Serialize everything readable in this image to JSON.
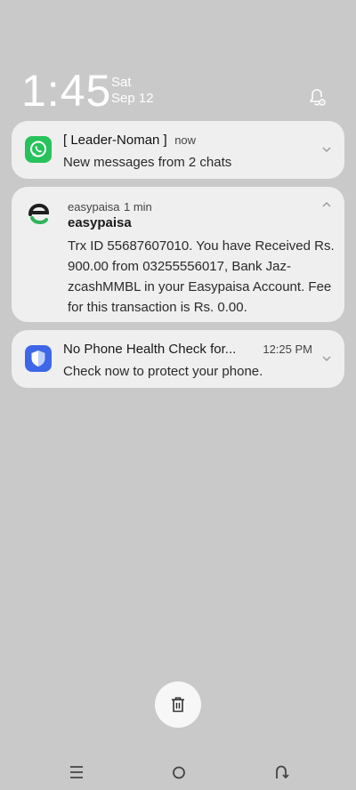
{
  "status": {
    "time": "1:45",
    "day": "Sat",
    "date": "Sep 12"
  },
  "notifications": [
    {
      "app_icon": "whatsapp-icon",
      "title": "[ Leader-Noman ]",
      "meta": "now",
      "body": "New messages from 2 chats",
      "accent": "#27c25b"
    },
    {
      "app_icon": "easypaisa-icon",
      "app_name": "easypaisa",
      "meta": "1 min",
      "title": "easypaisa",
      "body": "Trx ID 55687607010. You have Received Rs. 900.00 from 03255556017, Bank Jaz-zcashMMBL in your Easypaisa Account. Fee for this transaction is Rs. 0.00.",
      "accent": "#2fb45a"
    },
    {
      "app_icon": "shield-icon",
      "title": "No Phone Health Check for...",
      "time": "12:25 PM",
      "body": "Check now to protect your phone.",
      "accent": "#3d67e8"
    }
  ],
  "icons": {
    "bell": "notification-settings-icon",
    "clear": "trash-icon",
    "nav": [
      "menu-icon",
      "home-icon",
      "back-icon"
    ]
  },
  "colors": {
    "background": "#c9c9c9",
    "card": "#efefef"
  }
}
